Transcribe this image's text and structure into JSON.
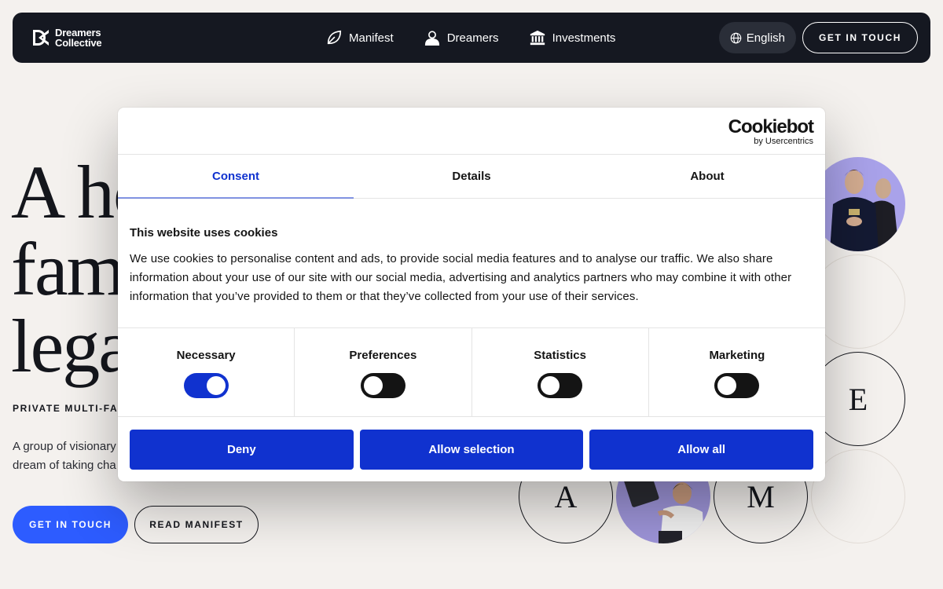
{
  "nav": {
    "logo_line1": "Dreamers",
    "logo_line2": "Collective",
    "links": [
      {
        "label": "Manifest",
        "icon": "leaf-icon"
      },
      {
        "label": "Dreamers",
        "icon": "person-icon"
      },
      {
        "label": "Investments",
        "icon": "bank-icon"
      }
    ],
    "language": "English",
    "cta": "GET IN TOUCH"
  },
  "hero": {
    "title_lines": [
      "A ho",
      "fam",
      "lega"
    ],
    "eyebrow": "PRIVATE MULTI-FAM",
    "desc_line1": "A group of visionary",
    "desc_line2": "dream of taking cha",
    "primary_button": "GET IN TOUCH",
    "secondary_button": "READ MANIFEST"
  },
  "circles": {
    "e": "E",
    "a": "A",
    "m": "M"
  },
  "cookie": {
    "brand": "Cookiebot",
    "brand_sub": "by Usercentrics",
    "tabs": [
      "Consent",
      "Details",
      "About"
    ],
    "heading": "This website uses cookies",
    "text": "We use cookies to personalise content and ads, to provide social media features and to analyse our traffic. We also share information about your use of our site with our social media, advertising and analytics partners who may combine it with other information that you’ve provided to them or that they’ve collected from your use of their services.",
    "toggles": [
      {
        "label": "Necessary",
        "on": true
      },
      {
        "label": "Preferences",
        "on": false
      },
      {
        "label": "Statistics",
        "on": false
      },
      {
        "label": "Marketing",
        "on": false
      }
    ],
    "buttons": {
      "deny": "Deny",
      "selection": "Allow selection",
      "all": "Allow all"
    }
  },
  "colors": {
    "accent": "#1032cf",
    "hero_button": "#2d5cff",
    "nav_bg": "#151821",
    "page_bg": "#f4f1ee"
  }
}
